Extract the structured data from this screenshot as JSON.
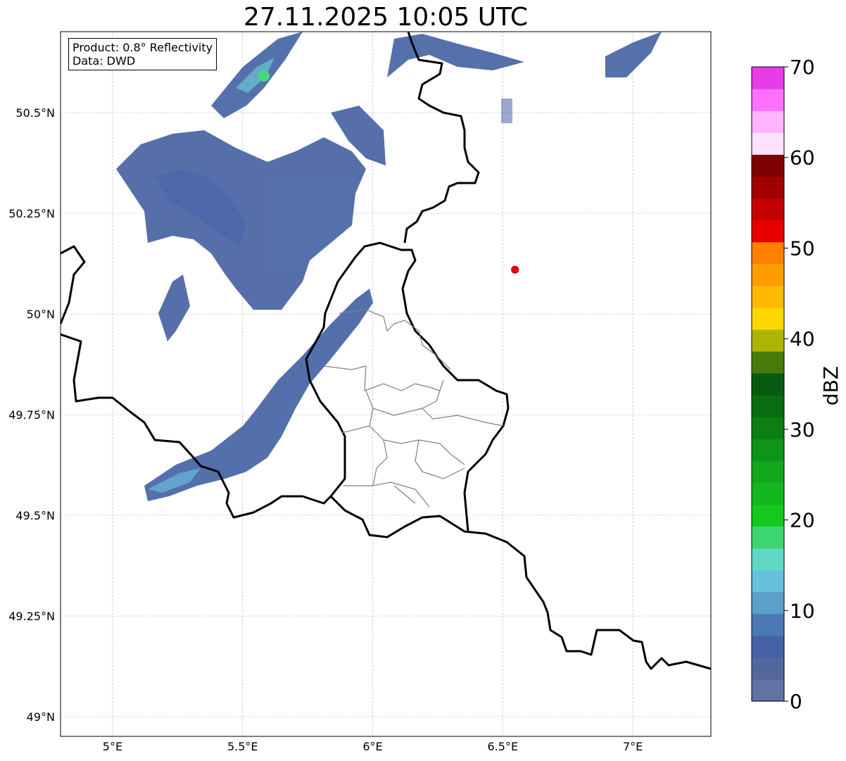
{
  "title": "27.11.2025 10:05 UTC",
  "info": {
    "product": "Product: 0.8° Reflectivity",
    "source": "Data: DWD"
  },
  "map": {
    "lon_range": [
      4.8,
      7.3
    ],
    "lat_range": [
      48.95,
      50.7
    ],
    "lon_ticks": [
      {
        "v": 5.0,
        "label": "5°E"
      },
      {
        "v": 5.5,
        "label": "5.5°E"
      },
      {
        "v": 6.0,
        "label": "6°E"
      },
      {
        "v": 6.5,
        "label": "6.5°E"
      },
      {
        "v": 7.0,
        "label": "7°E"
      }
    ],
    "lat_ticks": [
      {
        "v": 49.0,
        "label": "49°N"
      },
      {
        "v": 49.25,
        "label": "49.25°N"
      },
      {
        "v": 49.5,
        "label": "49.5°N"
      },
      {
        "v": 49.75,
        "label": "49.75°N"
      },
      {
        "v": 50.0,
        "label": "50°N"
      },
      {
        "v": 50.25,
        "label": "50.25°N"
      },
      {
        "v": 50.5,
        "label": "50.5°N"
      }
    ],
    "radar_site": {
      "lon": 6.547,
      "lat": 50.11,
      "color": "#ff0000"
    },
    "gridlines": true
  },
  "colorbar": {
    "label": "dBZ",
    "min": 0,
    "max": 70,
    "step": 2.5,
    "ticks": [
      "0",
      "10",
      "20",
      "30",
      "40",
      "50",
      "60",
      "70"
    ],
    "colors": [
      "#6272a6",
      "#53679f",
      "#4562a6",
      "#4a79b4",
      "#5aa0cb",
      "#66c1df",
      "#5fd9c4",
      "#3cd671",
      "#13c81f",
      "#12b81c",
      "#10a719",
      "#0e9416",
      "#0c7f13",
      "#0a6c11",
      "#085a0f",
      "#467a0a",
      "#afb304",
      "#ffd700",
      "#ffba00",
      "#ff9d00",
      "#ff7f00",
      "#e60000",
      "#c40000",
      "#a20000",
      "#7f0000",
      "#ffe2ff",
      "#ffb5ff",
      "#ff70ff",
      "#e83ce8"
    ]
  }
}
